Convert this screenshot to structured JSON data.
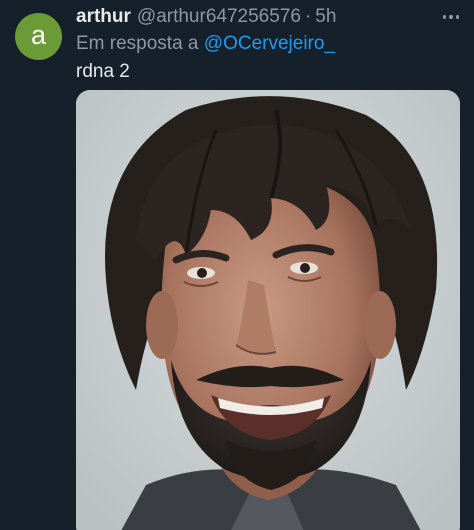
{
  "tweet": {
    "avatar_letter": "a",
    "display_name": "arthur",
    "handle": "@arthur647256576",
    "separator": "·",
    "time": "5h",
    "reply_prefix": "Em resposta a",
    "reply_to": "@OCervejeiro_",
    "body": "rdna 2"
  },
  "icons": {
    "more": "more-options-icon"
  },
  "colors": {
    "background": "#15202b",
    "text": "#e7e9ea",
    "secondary": "#8b98a5",
    "link": "#1d9bf0",
    "avatar": "#6b9b37"
  }
}
